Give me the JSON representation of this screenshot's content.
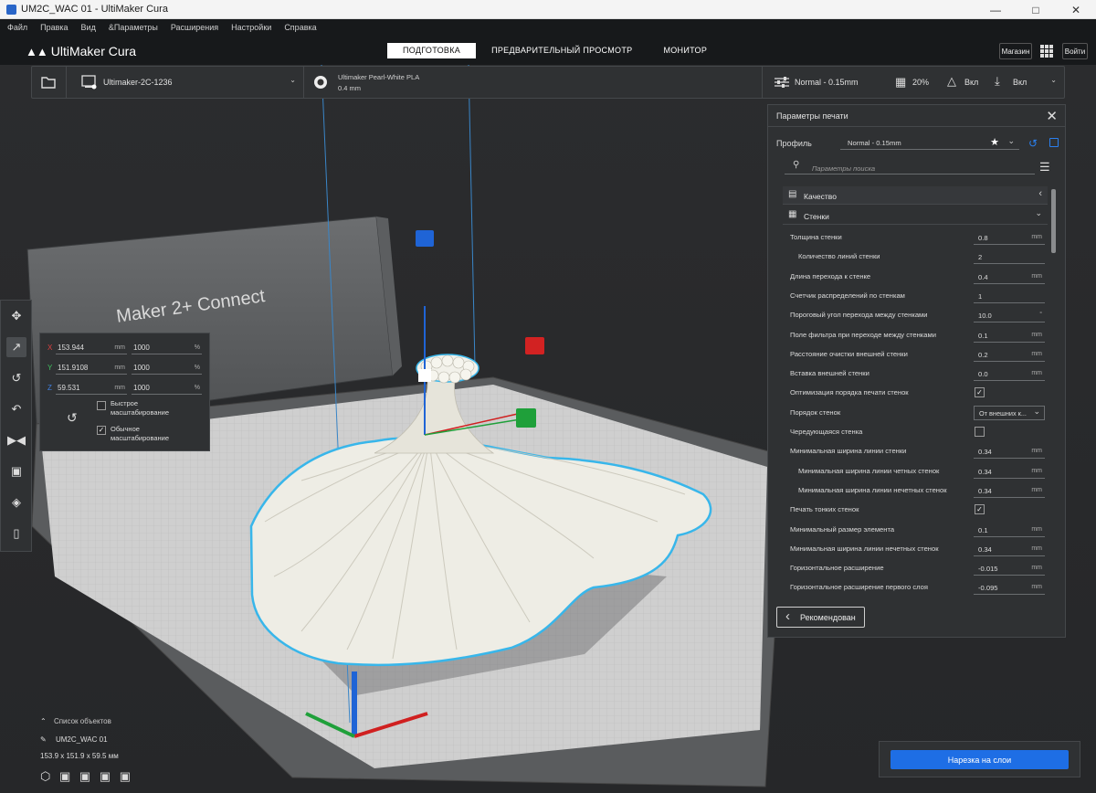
{
  "window": {
    "title": "UM2C_WAC 01 - UltiMaker Cura"
  },
  "menu": [
    "Файл",
    "Правка",
    "Вид",
    "&Параметры",
    "Расширения",
    "Настройки",
    "Справка"
  ],
  "header": {
    "logo": "UltiMaker Cura",
    "stages": [
      "ПОДГОТОВКА",
      "ПРЕДВАРИТЕЛЬНЫЙ ПРОСМОТР",
      "МОНИТОР"
    ],
    "active_stage": 0,
    "marketplace": "Магазин",
    "signin": "Войти"
  },
  "toolbar": {
    "printer": "Ultimaker-2C-1236",
    "material_name": "Ultimaker Pearl-White PLA",
    "nozzle": "0.4 mm",
    "profile": "Normal - 0.15mm",
    "infill": "20%",
    "support": "Вкл",
    "adhesion": "Вкл"
  },
  "build_plate_label": "Maker 2+ Connect",
  "scale_panel": {
    "rows": [
      {
        "axis": "X",
        "mm": "153.944",
        "pct": "1000"
      },
      {
        "axis": "Y",
        "mm": "151.9108",
        "pct": "1000"
      },
      {
        "axis": "Z",
        "mm": "59.531",
        "pct": "1000"
      }
    ],
    "unit_mm": "mm",
    "unit_pct": "%",
    "snap_label_1": "Быстрое",
    "snap_label_2": "масштабирование",
    "snap_checked": false,
    "uniform_label_1": "Обычное",
    "uniform_label_2": "масштабирование",
    "uniform_checked": true
  },
  "settings_panel": {
    "title": "Параметры печати",
    "profile_label": "Профиль",
    "profile_value": "Normal - 0.15mm",
    "search_placeholder": "Параметры поиска",
    "categories": [
      {
        "name": "Качество",
        "expanded": false
      },
      {
        "name": "Стенки",
        "expanded": true
      }
    ],
    "settings": [
      {
        "label": "Толщина стенки",
        "value": "0.8",
        "unit": "mm",
        "indent": false,
        "type": "field"
      },
      {
        "label": "Количество линий стенки",
        "value": "2",
        "unit": "",
        "indent": true,
        "type": "field"
      },
      {
        "label": "Длина перехода к стенке",
        "value": "0.4",
        "unit": "mm",
        "indent": false,
        "type": "field"
      },
      {
        "label": "Счетчик распределений по стенкам",
        "value": "1",
        "unit": "",
        "indent": false,
        "type": "field"
      },
      {
        "label": "Пороговый угол перехода между стенками",
        "value": "10.0",
        "unit": "°",
        "indent": false,
        "type": "field"
      },
      {
        "label": "Поле фильтра при переходе между стенками",
        "value": "0.1",
        "unit": "mm",
        "indent": false,
        "type": "field"
      },
      {
        "label": "Расстояние очистки внешней стенки",
        "value": "0.2",
        "unit": "mm",
        "indent": false,
        "type": "field"
      },
      {
        "label": "Вставка внешней стенки",
        "value": "0.0",
        "unit": "mm",
        "indent": false,
        "type": "field"
      },
      {
        "label": "Оптимизация порядка печати стенок",
        "value": "✓",
        "unit": "",
        "indent": false,
        "type": "check"
      },
      {
        "label": "Порядок стенок",
        "value": "От внешних к...",
        "unit": "",
        "indent": false,
        "type": "select"
      },
      {
        "label": "Чередующаяся стенка",
        "value": "",
        "unit": "",
        "indent": false,
        "type": "check"
      },
      {
        "label": "Минимальная ширина линии стенки",
        "value": "0.34",
        "unit": "mm",
        "indent": false,
        "type": "field"
      },
      {
        "label": "Минимальная ширина линии четных стенок",
        "value": "0.34",
        "unit": "mm",
        "indent": true,
        "type": "field"
      },
      {
        "label": "Минимальная ширина линии нечетных стенок",
        "value": "0.34",
        "unit": "mm",
        "indent": true,
        "type": "field"
      },
      {
        "label": "Печать тонких стенок",
        "value": "✓",
        "unit": "",
        "indent": false,
        "type": "check"
      },
      {
        "label": "Минимальный размер элемента",
        "value": "0.1",
        "unit": "mm",
        "indent": false,
        "type": "field"
      },
      {
        "label": "Минимальная ширина линии нечетных стенок",
        "value": "0.34",
        "unit": "mm",
        "indent": false,
        "type": "field"
      },
      {
        "label": "Горизонтальное расширение",
        "value": "-0.015",
        "unit": "mm",
        "indent": false,
        "type": "field"
      },
      {
        "label": "Горизонтальное расширение первого слоя",
        "value": "-0.095",
        "unit": "mm",
        "indent": false,
        "type": "field"
      }
    ],
    "recommended_button": "Рекомендован"
  },
  "object_list": {
    "header": "Список объектов",
    "object_name": "UM2C_WAC 01",
    "dimensions": "153.9 x 151.9 x 59.5 мм"
  },
  "slice_button": "Нарезка на слои",
  "colors": {
    "accent": "#1e6ee5",
    "outline": "#37b8e8",
    "model": "#ecebe3"
  }
}
